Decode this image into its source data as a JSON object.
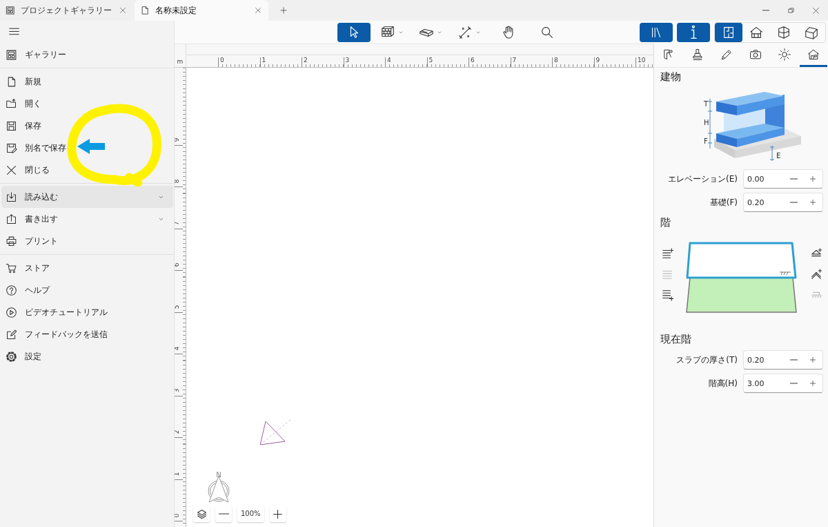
{
  "tabs": [
    {
      "label": "プロジェクトギャラリー",
      "selected": false
    },
    {
      "label": "名称未設定",
      "selected": true
    }
  ],
  "toolbar": {
    "tools": [
      {
        "selected": true,
        "dropdown": false
      },
      {
        "selected": false,
        "dropdown": true
      },
      {
        "selected": false,
        "dropdown": true
      },
      {
        "selected": false,
        "dropdown": true
      },
      {
        "selected": false,
        "dropdown": false
      },
      {
        "selected": false,
        "dropdown": false
      }
    ],
    "panels": [
      {
        "selected": true
      },
      {
        "selected": true
      }
    ],
    "views": [
      {
        "selected": true
      },
      {
        "selected": false
      },
      {
        "selected": false
      },
      {
        "selected": false
      }
    ]
  },
  "menu": {
    "sections": [
      [
        {
          "label": "ギャラリー",
          "expandable": false,
          "selected": false
        }
      ],
      [
        {
          "label": "新規",
          "expandable": false,
          "selected": false
        },
        {
          "label": "開く",
          "expandable": false,
          "selected": false
        },
        {
          "label": "保存",
          "expandable": false,
          "selected": false
        },
        {
          "label": "別名で保存",
          "expandable": false,
          "selected": false
        },
        {
          "label": "閉じる",
          "expandable": false,
          "selected": false
        }
      ],
      [
        {
          "label": "読み込む",
          "expandable": true,
          "selected": true
        },
        {
          "label": "書き出す",
          "expandable": true,
          "selected": false
        },
        {
          "label": "プリント",
          "expandable": false,
          "selected": false
        }
      ],
      [
        {
          "label": "ストア",
          "expandable": false,
          "selected": false
        },
        {
          "label": "ヘルプ",
          "expandable": false,
          "selected": false
        },
        {
          "label": "ビデオチュートリアル",
          "expandable": false,
          "selected": false
        },
        {
          "label": "フィードバックを送信",
          "expandable": false,
          "selected": false
        },
        {
          "label": "設定",
          "expandable": false,
          "selected": false
        }
      ]
    ]
  },
  "annotations": {
    "circle": true,
    "arrow": true
  },
  "ruler": {
    "unit": "m",
    "x_labels": [
      "0",
      "1",
      "2",
      "3",
      "4",
      "5",
      "6",
      "7",
      "8",
      "9",
      "10"
    ],
    "y_labels": [
      "9",
      "8",
      "7",
      "6",
      "5",
      "4",
      "3",
      "2",
      "1",
      "0"
    ]
  },
  "canvas": {
    "zoom": "100%",
    "compass": "N"
  },
  "side_tabs": [
    {
      "selected": false
    },
    {
      "selected": false
    },
    {
      "selected": false
    },
    {
      "selected": false
    },
    {
      "selected": false
    },
    {
      "selected": true
    }
  ],
  "building": {
    "title": "建物",
    "diagram_labels": [
      "T",
      "H",
      "F",
      "E"
    ],
    "fields": [
      {
        "label": "エレベーション(E)",
        "value": "0.00"
      },
      {
        "label": "基礎(F)",
        "value": "0.20"
      }
    ]
  },
  "levels": {
    "title": "階",
    "left_actions": [
      {
        "disabled": false
      },
      {
        "disabled": true
      },
      {
        "disabled": false
      }
    ],
    "right_actions": [
      {
        "disabled": false
      },
      {
        "disabled": false
      },
      {
        "disabled": true
      }
    ]
  },
  "current_level": {
    "title": "現在階",
    "fields": [
      {
        "label": "スラブの厚さ(T)",
        "value": "0.20"
      },
      {
        "label": "階高(H)",
        "value": "3.00"
      }
    ]
  }
}
